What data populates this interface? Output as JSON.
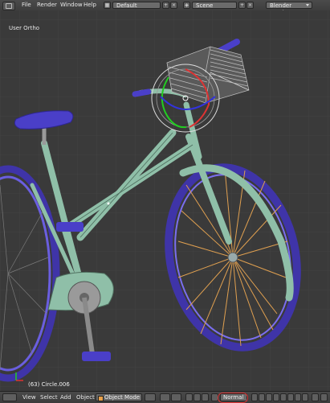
{
  "topbar": {
    "menus": [
      "File",
      "Render",
      "Window",
      "Help"
    ],
    "screen_layout": "Default",
    "scene": "Scene",
    "render_engine": "Blender Render"
  },
  "viewport": {
    "view_label": "User Ortho",
    "object_label": "(63) Circle.006"
  },
  "bottombar": {
    "menus": [
      "View",
      "Select",
      "Add",
      "Object"
    ],
    "mode": "Object Mode",
    "transform_orientation": "Normal"
  },
  "colors": {
    "frame": "#8fbfa8",
    "tire": "#5a4bd0",
    "spokes": "#e0a050",
    "basket": "#bdbdbd",
    "accent_selection": "#f0a040"
  },
  "icons": [
    "editor-type-icon",
    "add-icon",
    "close-icon",
    "viewport-shading-icon",
    "manipulator-icon",
    "snap-icon",
    "magnet-icon"
  ]
}
